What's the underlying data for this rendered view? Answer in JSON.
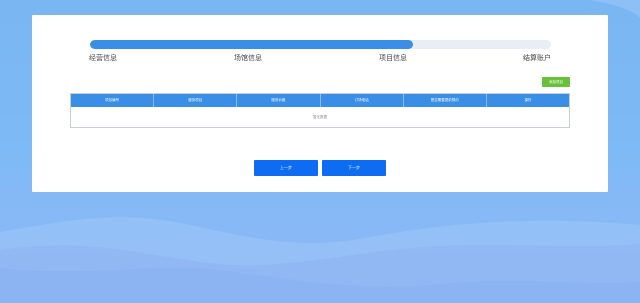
{
  "progress": {
    "percent": 70,
    "steps": [
      "经营信息",
      "场馆信息",
      "项目信息",
      "结算账户"
    ]
  },
  "toolbar": {
    "add_label": "添加项目"
  },
  "table": {
    "headers": [
      "项目编号",
      "服务项目",
      "服务价格",
      "订场电话",
      "是否需要提前预约",
      "操作"
    ],
    "empty_text": "暂无数据"
  },
  "nav": {
    "prev_label": "上一步",
    "next_label": "下一步"
  },
  "colors": {
    "accent": "#3a8ee6",
    "primary_button": "#0d6cf2",
    "add_button": "#67c23a"
  }
}
